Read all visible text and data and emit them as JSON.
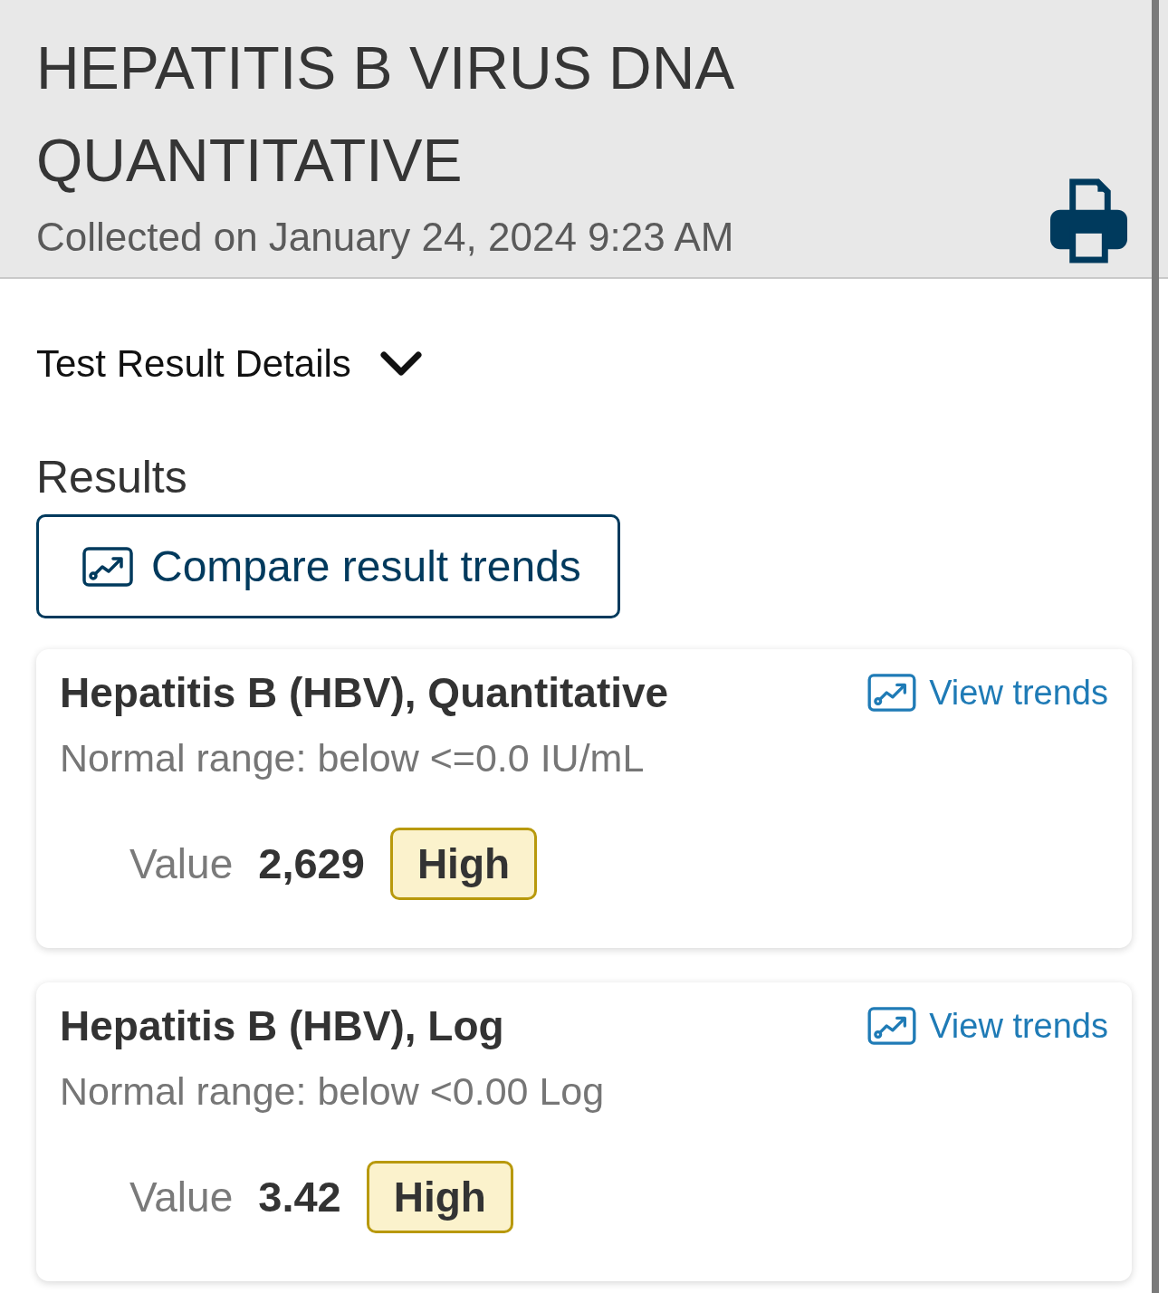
{
  "header": {
    "title": "HEPATITIS B VIRUS DNA QUANTITATIVE",
    "subtitle": "Collected on January 24, 2024 9:23 AM"
  },
  "details_toggle": {
    "label": "Test Result Details",
    "expanded": false
  },
  "results": {
    "heading": "Results",
    "compare_button": "Compare result trends",
    "items": [
      {
        "name": "Hepatitis B (HBV), Quantitative",
        "trends_link": "View trends",
        "normal_range": "Normal range: below <=0.0 IU/mL",
        "value_label": "Value",
        "value": "2,629",
        "flag": "High"
      },
      {
        "name": "Hepatitis B (HBV), Log",
        "trends_link": "View trends",
        "normal_range": "Normal range: below <0.00 Log",
        "value_label": "Value",
        "value": "3.42",
        "flag": "High"
      }
    ]
  }
}
